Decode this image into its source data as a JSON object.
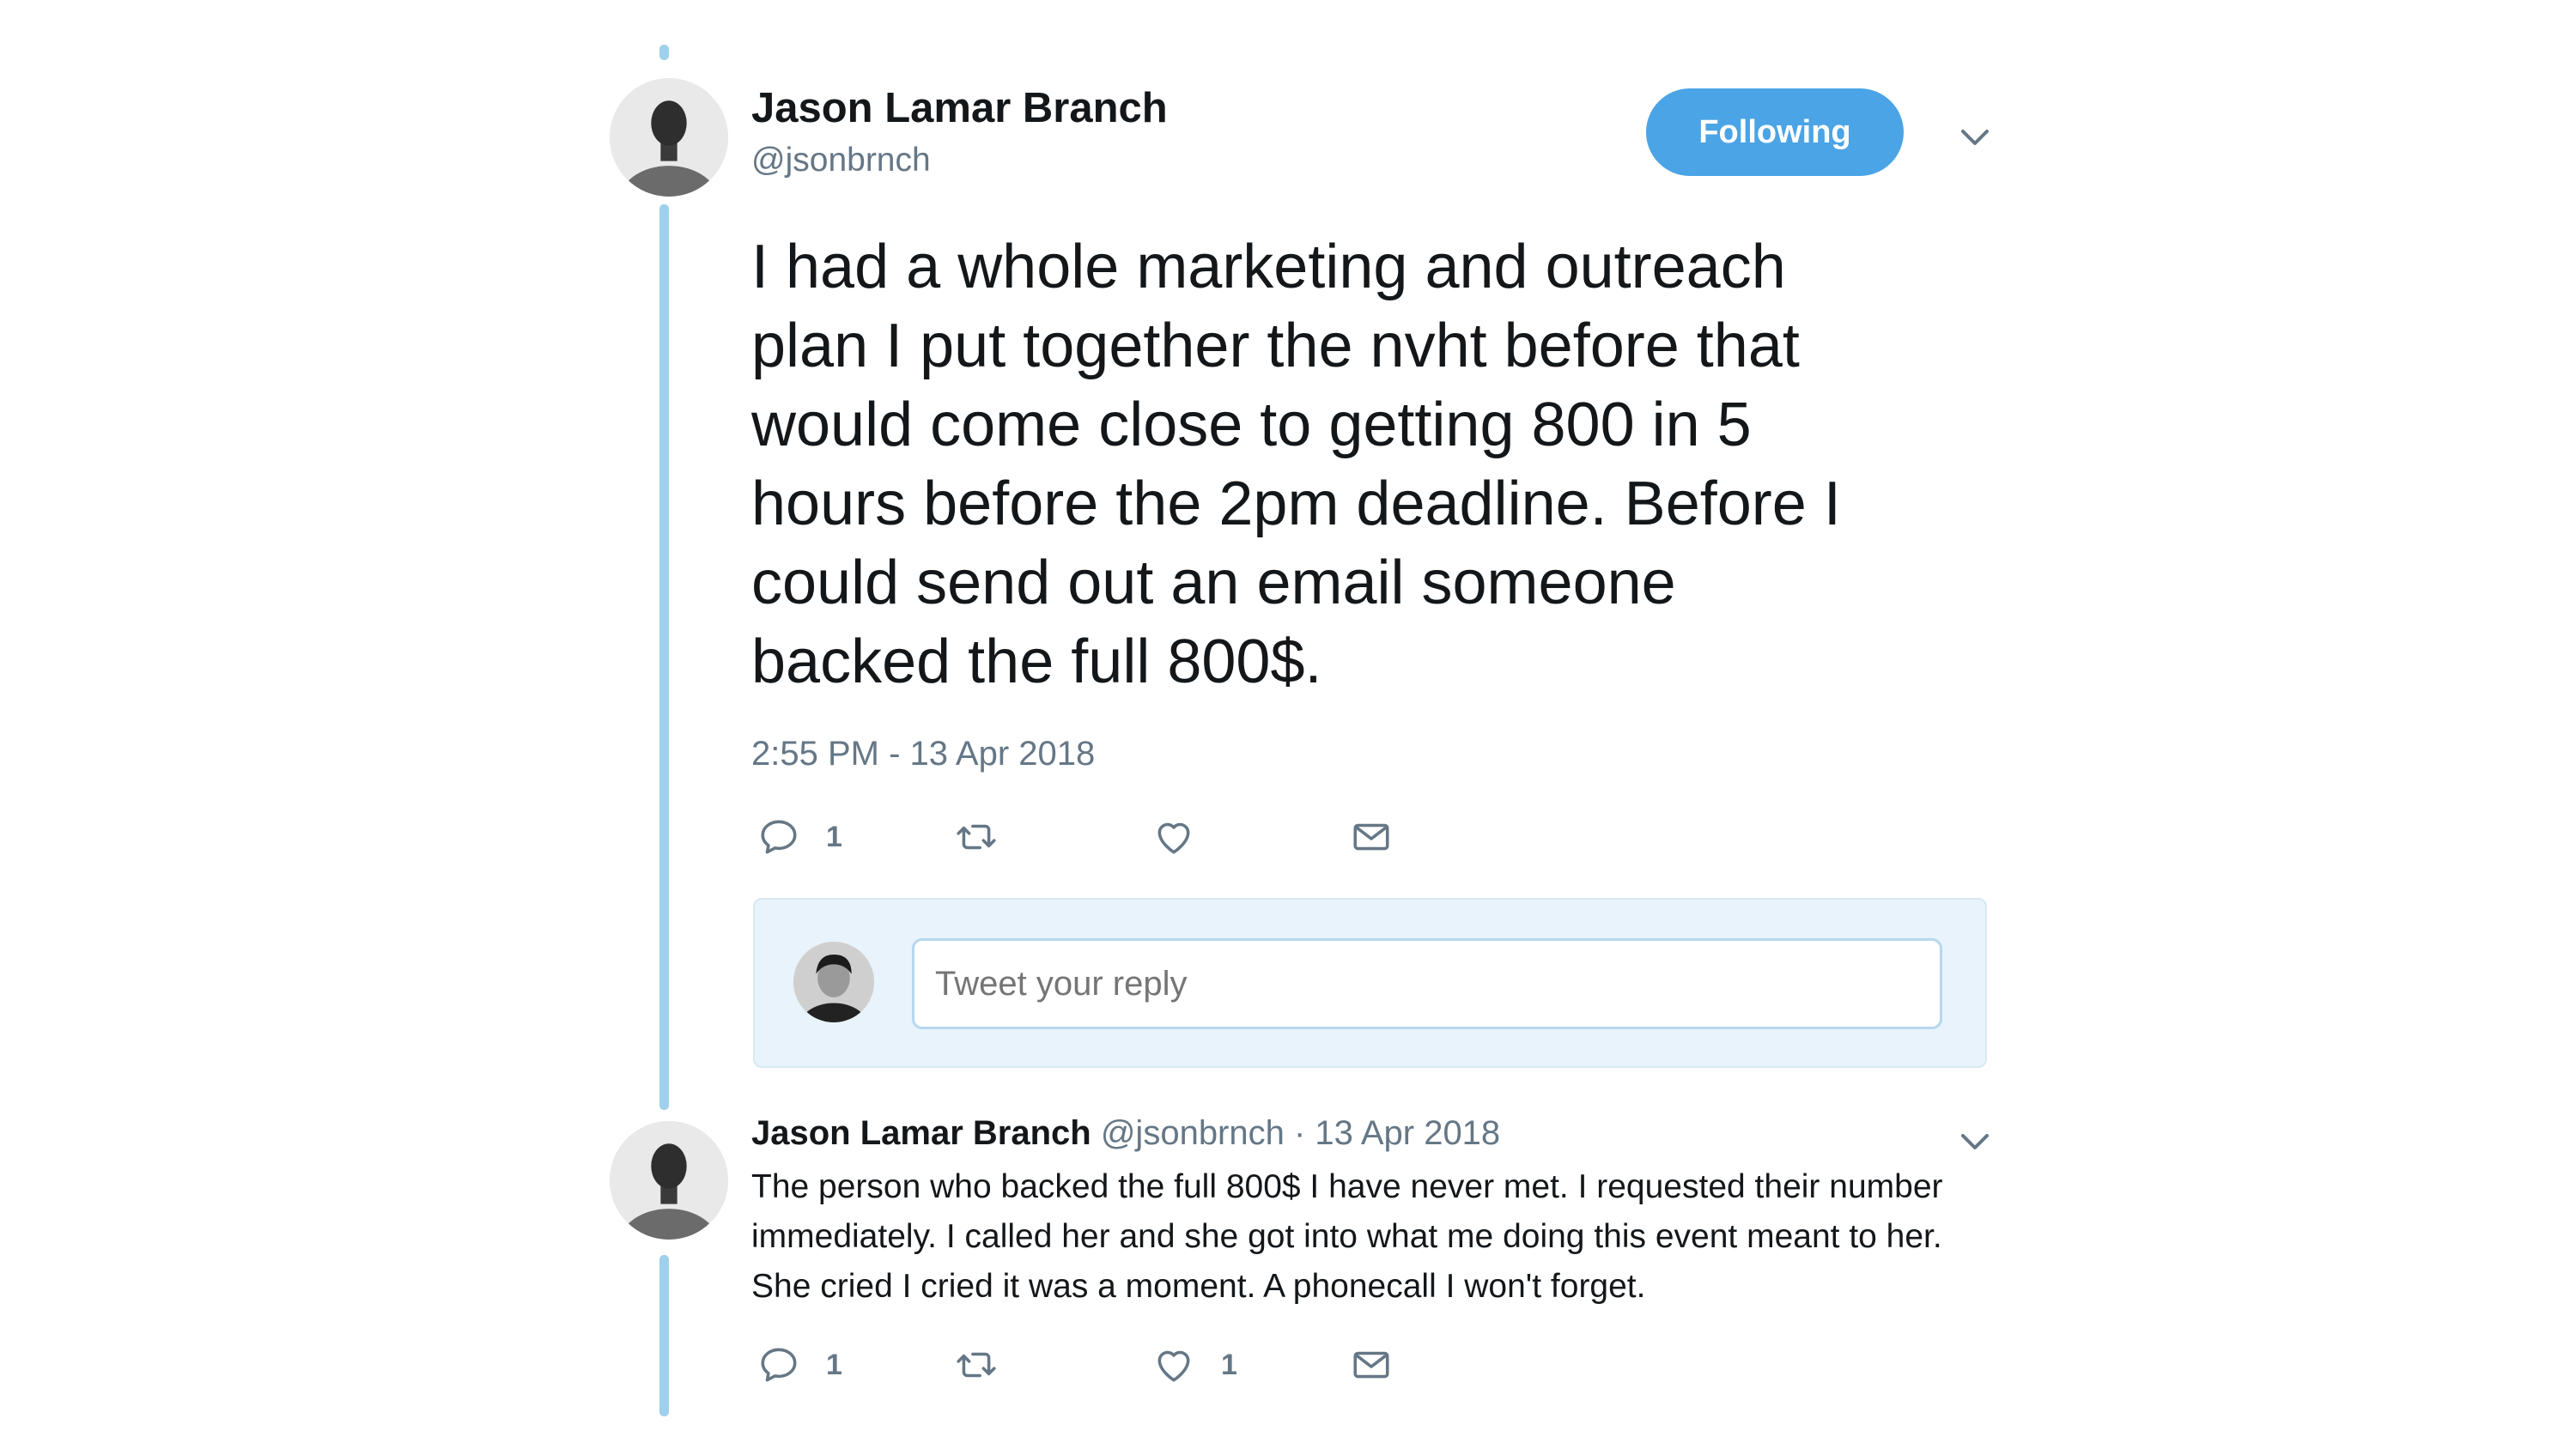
{
  "main_tweet": {
    "author_name": "Jason Lamar Branch",
    "author_handle": "@jsonbrnch",
    "follow_label": "Following",
    "text": "I had a whole marketing and outreach\nplan I put together the nvht before that\nwould come close to getting 800 in 5\nhours before the 2pm deadline. Before I\ncould send out an email someone\nbacked the full 800$.",
    "timestamp": "2:55 PM - 13 Apr 2018",
    "actions": {
      "reply_count": "1",
      "retweet_count": "",
      "like_count": ""
    }
  },
  "reply_composer": {
    "placeholder": "Tweet your reply"
  },
  "reply_tweet": {
    "author_name": "Jason Lamar Branch",
    "author_handle": "@jsonbrnch",
    "date": "· 13 Apr 2018",
    "text": "The person who backed the full 800$ I have never met. I requested their number immediately. I called her and she got into what me doing this event meant to her. She cried I cried it was a moment. A phonecall I won't forget.",
    "actions": {
      "reply_count": "1",
      "retweet_count": "",
      "like_count": "1"
    }
  },
  "icons": {
    "reply": "reply-icon",
    "retweet": "retweet-icon",
    "like": "heart-icon",
    "message": "envelope-icon",
    "more": "chevron-down-icon"
  },
  "colors": {
    "accent": "#4aa4e6",
    "thread_line": "#9fd0ec",
    "secondary_text": "#657786",
    "reply_box_bg": "#e8f3fb"
  }
}
